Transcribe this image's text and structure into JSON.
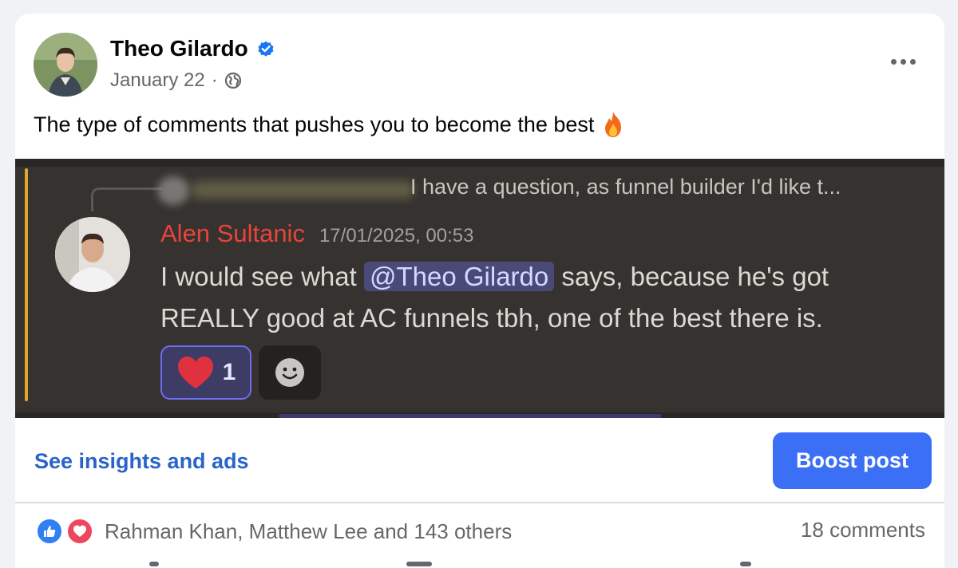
{
  "post": {
    "author": "Theo Gilardo",
    "date": "January 22",
    "separator": "·",
    "privacy_icon": "globe-icon",
    "text": "The type of comments that pushes you to become the best",
    "emoji": "fire-emoji"
  },
  "screenshot": {
    "reply_preview": "I have a question, as funnel builder I'd like t...",
    "commenter": "Alen Sultanic",
    "timestamp": "17/01/2025, 00:53",
    "body_before": "I would see what ",
    "mention": "@Theo Gilardo",
    "body_after": " says, because he's got REALLY good at AC funnels tbh, one of the best there is.",
    "reaction_count": "1"
  },
  "actions": {
    "insights_label": "See insights and ads",
    "boost_label": "Boost post"
  },
  "footer": {
    "reactions_text": "Rahman Khan, Matthew Lee and 143 others",
    "comments_text": "18 comments"
  },
  "colors": {
    "accent_blue": "#3b6ff5",
    "link_blue": "#2a64c8",
    "verified_blue": "#1877f2",
    "like_blue": "#2f7ff5",
    "love_red": "#f0455f",
    "commenter_red": "#e8443a",
    "screenshot_bg": "#353230"
  }
}
